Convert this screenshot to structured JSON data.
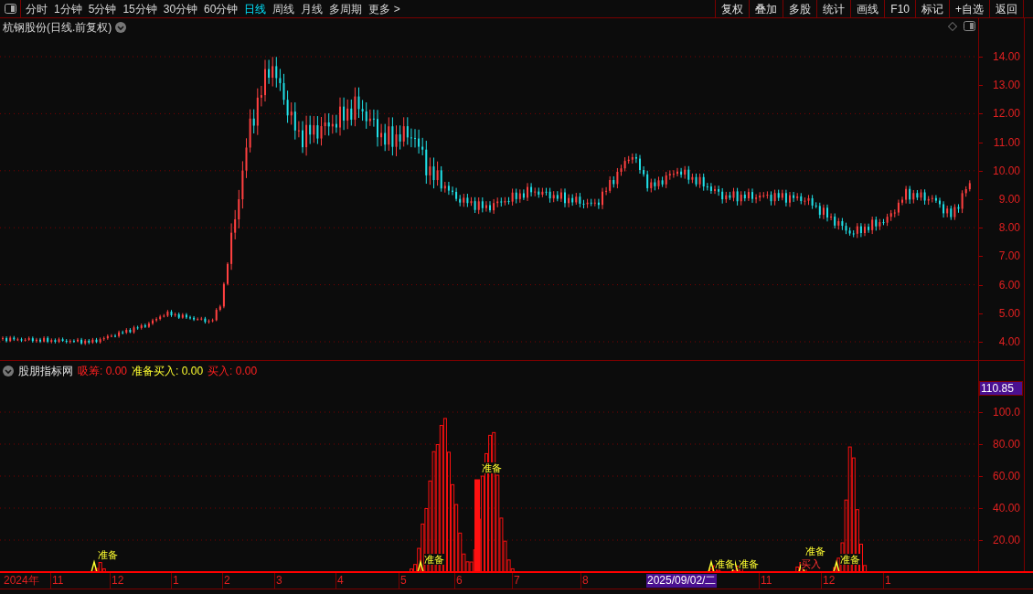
{
  "periods": [
    {
      "label": "分时",
      "selected": false
    },
    {
      "label": "1分钟",
      "selected": false
    },
    {
      "label": "5分钟",
      "selected": false
    },
    {
      "label": "15分钟",
      "selected": false
    },
    {
      "label": "30分钟",
      "selected": false
    },
    {
      "label": "60分钟",
      "selected": false
    },
    {
      "label": "日线",
      "selected": true
    },
    {
      "label": "周线",
      "selected": false
    },
    {
      "label": "月线",
      "selected": false
    },
    {
      "label": "多周期",
      "selected": false
    },
    {
      "label": "更多 >",
      "selected": false
    }
  ],
  "toolbar_buttons": [
    "复权",
    "叠加",
    "多股",
    "统计",
    "画线",
    "F10",
    "标记",
    "+自选",
    "返回"
  ],
  "chart_title": "杭钢股份(日线.前复权)",
  "price_axis": [
    "14.00",
    "13.00",
    "12.00",
    "11.00",
    "10.00",
    "9.00",
    "8.00",
    "7.00",
    "6.00",
    "5.00",
    "4.00"
  ],
  "indicator": {
    "name": "股朋指标网",
    "legend": [
      {
        "kind": "accumulate",
        "label": "吸筹: 0.00"
      },
      {
        "kind": "prepare",
        "label": "准备买入: 0.00"
      },
      {
        "kind": "buy",
        "label": "买入: 0.00"
      }
    ],
    "current_value": "110.85",
    "axis": [
      "100.0",
      "80.00",
      "60.00",
      "40.00",
      "20.00"
    ],
    "signals": [
      {
        "kind": "prepare",
        "label": "准备"
      },
      {
        "kind": "prepare",
        "label": "准备"
      },
      {
        "kind": "prepare",
        "label": "准备"
      },
      {
        "kind": "prepare",
        "label": "准备"
      },
      {
        "kind": "prepare",
        "label": "准备"
      },
      {
        "kind": "buy",
        "label": "买入"
      },
      {
        "kind": "prepare",
        "label": "准备"
      },
      {
        "kind": "prepare",
        "label": "准备"
      }
    ]
  },
  "time_axis": [
    {
      "kind": "tick",
      "label": "2024年"
    },
    {
      "kind": "tick",
      "label": "11"
    },
    {
      "kind": "tick",
      "label": "12"
    },
    {
      "kind": "tick",
      "label": "1"
    },
    {
      "kind": "tick",
      "label": "2"
    },
    {
      "kind": "tick",
      "label": "3"
    },
    {
      "kind": "tick",
      "label": "4"
    },
    {
      "kind": "tick",
      "label": "5"
    },
    {
      "kind": "tick",
      "label": "6"
    },
    {
      "kind": "tick",
      "label": "7"
    },
    {
      "kind": "tick",
      "label": "8"
    },
    {
      "kind": "cursor",
      "label": "2025/09/02/二"
    },
    {
      "kind": "tick",
      "label": "11"
    },
    {
      "kind": "tick",
      "label": "12"
    },
    {
      "kind": "tick",
      "label": "1"
    }
  ]
}
